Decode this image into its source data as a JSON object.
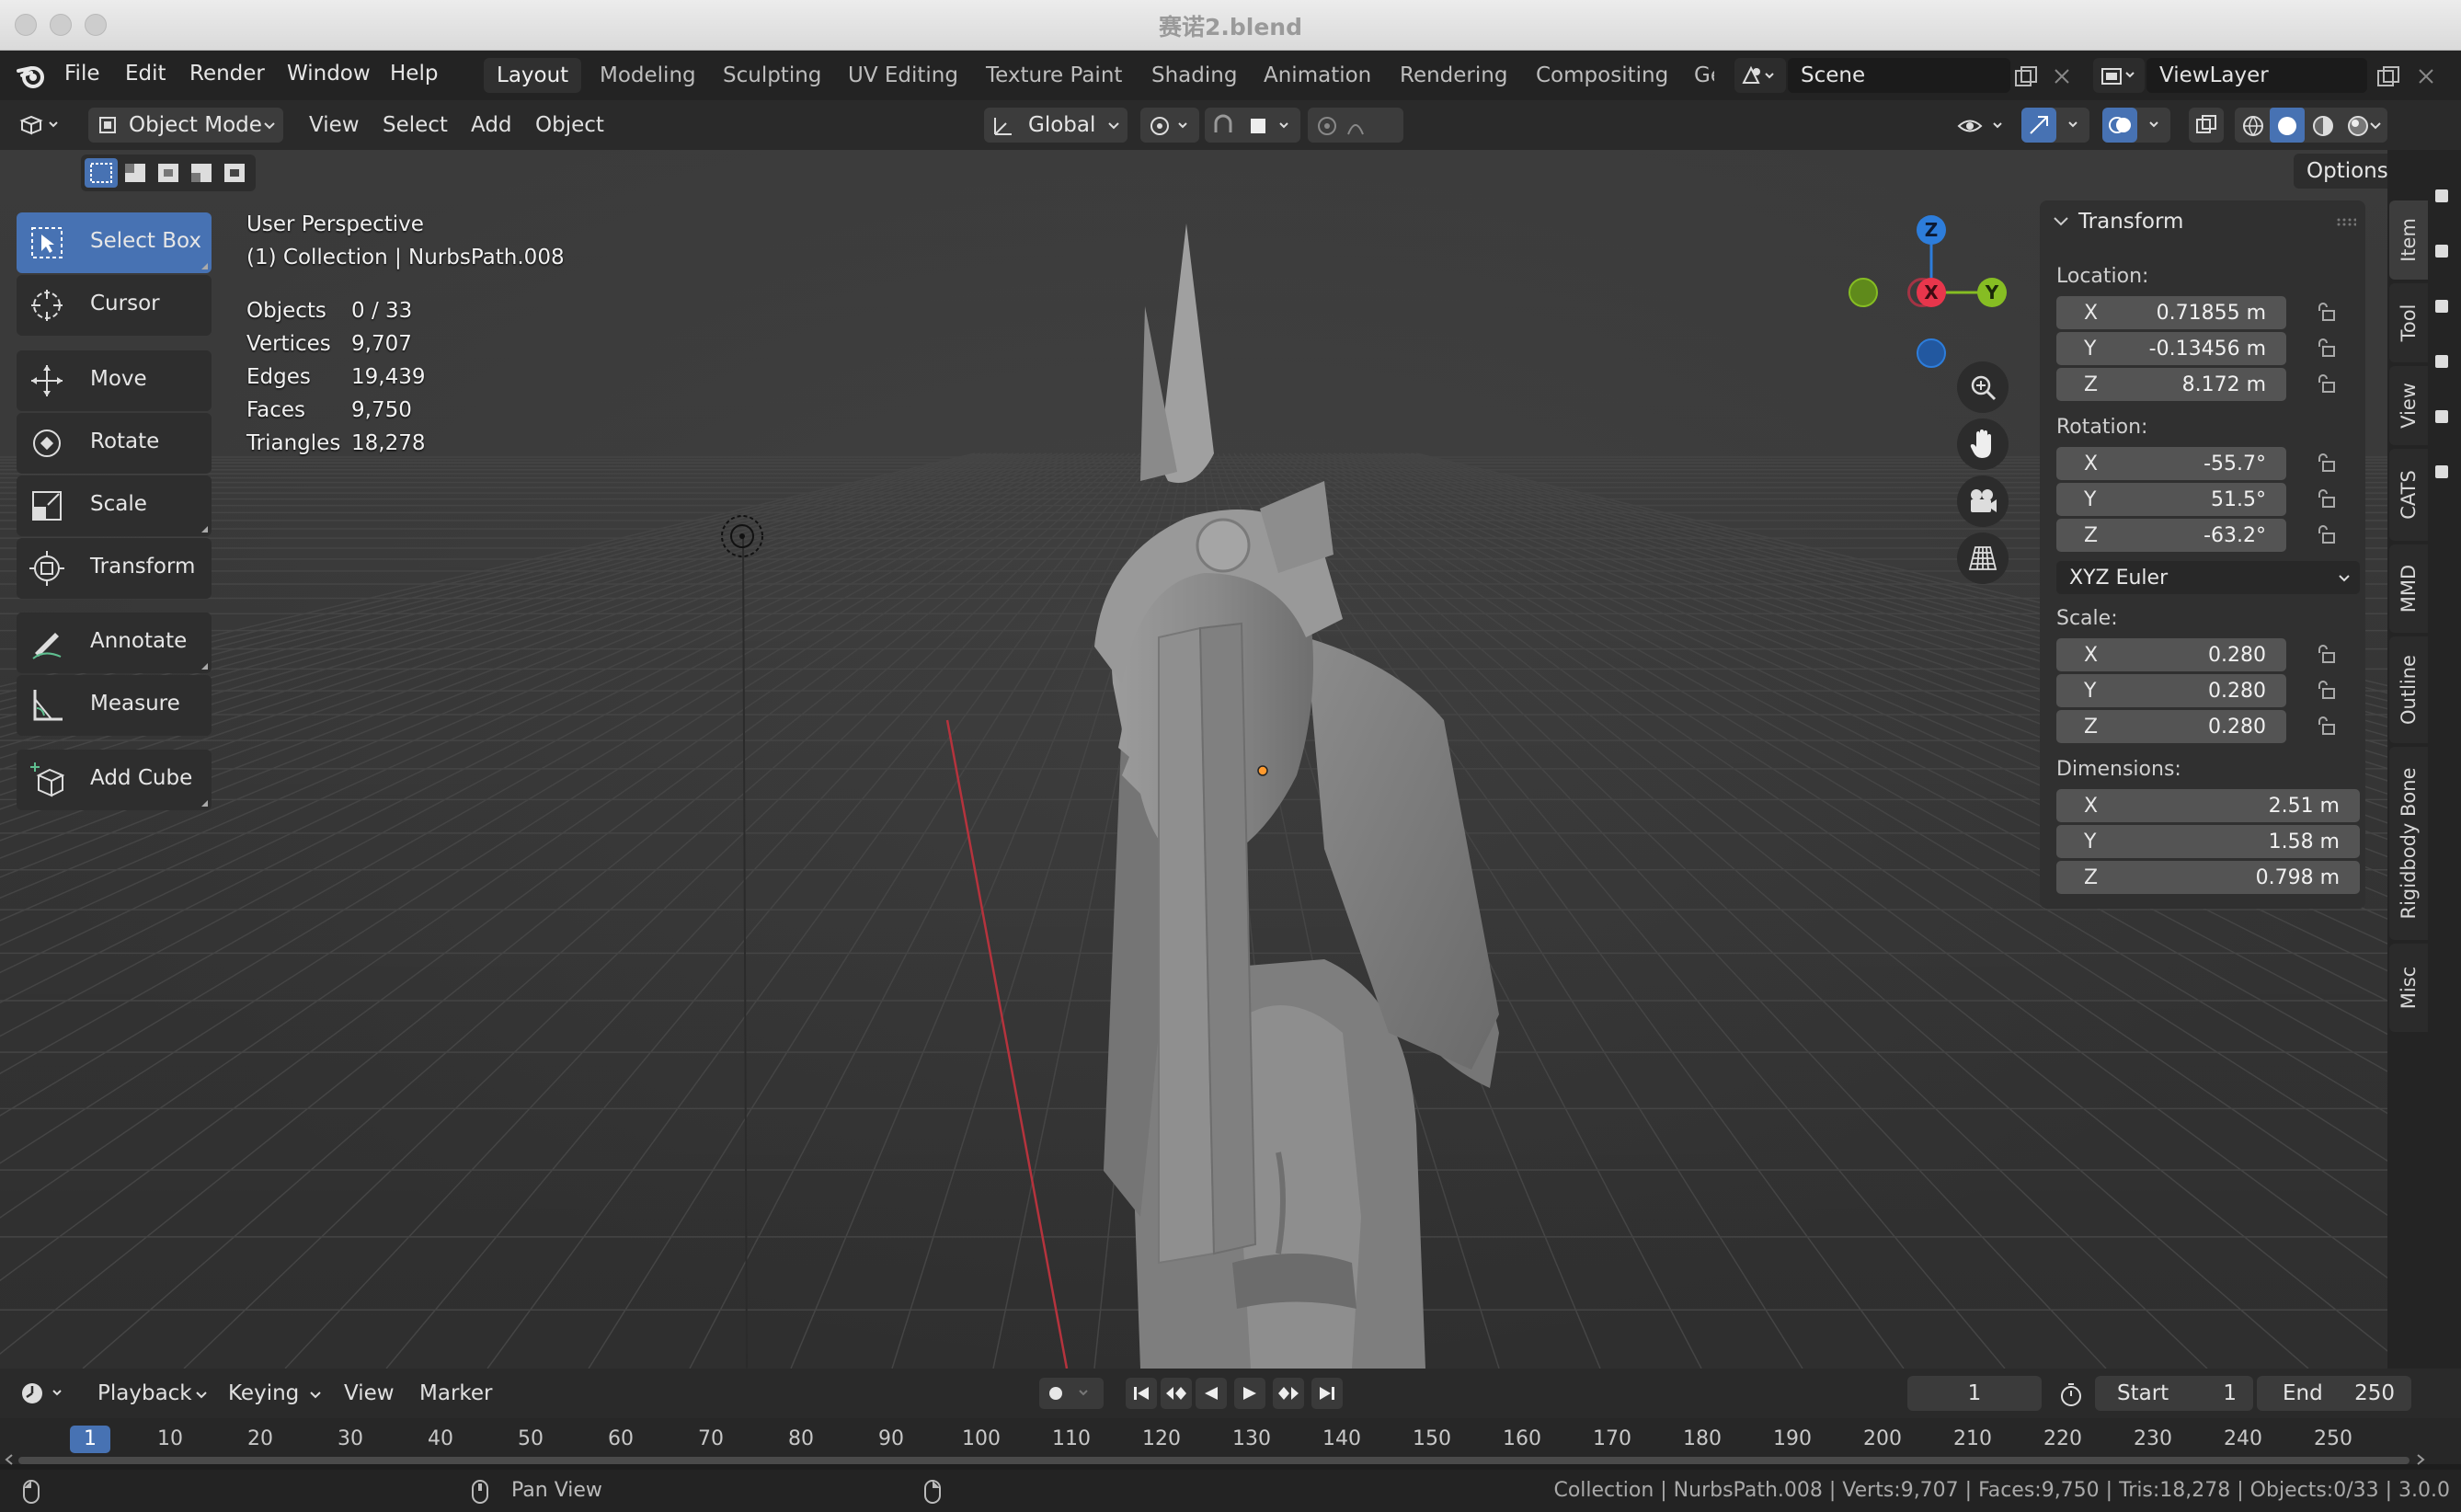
{
  "window": {
    "title": "赛诺2.blend"
  },
  "menu": {
    "items": [
      "File",
      "Edit",
      "Render",
      "Window",
      "Help"
    ]
  },
  "workspaces": {
    "tabs": [
      "Layout",
      "Modeling",
      "Sculpting",
      "UV Editing",
      "Texture Paint",
      "Shading",
      "Animation",
      "Rendering",
      "Compositing",
      "Ge"
    ],
    "active": "Layout"
  },
  "scene": {
    "name": "Scene",
    "view_layer": "ViewLayer"
  },
  "header": {
    "mode": "Object Mode",
    "view": "View",
    "select": "Select",
    "add": "Add",
    "object": "Object",
    "orientation": "Global",
    "options": "Options"
  },
  "toolbar": {
    "tools": [
      "Select Box",
      "Cursor",
      "Move",
      "Rotate",
      "Scale",
      "Transform",
      "Annotate",
      "Measure",
      "Add Cube"
    ],
    "active": "Select Box"
  },
  "viewport": {
    "perspective": "User Perspective",
    "collection": "(1) Collection | NurbsPath.008",
    "stats": [
      {
        "label": "Objects",
        "value": "0 / 33"
      },
      {
        "label": "Vertices",
        "value": "9,707"
      },
      {
        "label": "Edges",
        "value": "19,439"
      },
      {
        "label": "Faces",
        "value": "9,750"
      },
      {
        "label": "Triangles",
        "value": "18,278"
      }
    ],
    "gizmo": {
      "x": "X",
      "y": "Y",
      "z": "Z"
    }
  },
  "transform_panel": {
    "title": "Transform",
    "location_label": "Location:",
    "location": {
      "x": "0.71855 m",
      "y": "-0.13456 m",
      "z": "8.172 m"
    },
    "rotation_label": "Rotation:",
    "rotation": {
      "x": "-55.7°",
      "y": "51.5°",
      "z": "-63.2°"
    },
    "rotation_mode": "XYZ Euler",
    "scale_label": "Scale:",
    "scale": {
      "x": "0.280",
      "y": "0.280",
      "z": "0.280"
    },
    "dimensions_label": "Dimensions:",
    "dimensions": {
      "x": "2.51 m",
      "y": "1.58 m",
      "z": "0.798 m"
    },
    "axis_labels": {
      "x": "X",
      "y": "Y",
      "z": "Z"
    }
  },
  "sidebar_tabs": [
    "Item",
    "Tool",
    "View",
    "CATS",
    "MMD",
    "Outline",
    "Rigidbody Bone",
    "Misc"
  ],
  "timeline": {
    "playback": "Playback",
    "keying": "Keying",
    "view": "View",
    "marker": "Marker",
    "current_frame": "1",
    "start_label": "Start",
    "start": "1",
    "end_label": "End",
    "end": "250",
    "ruler": [
      "1",
      "10",
      "20",
      "30",
      "40",
      "50",
      "60",
      "70",
      "80",
      "90",
      "100",
      "110",
      "120",
      "130",
      "140",
      "150",
      "160",
      "170",
      "180",
      "190",
      "200",
      "210",
      "220",
      "230",
      "240",
      "250"
    ]
  },
  "statusbar": {
    "middle_hint": "Pan View",
    "info": "Collection | NurbsPath.008 | Verts:9,707 | Faces:9,750 | Tris:18,278 | Objects:0/33 | 3.0.0"
  },
  "colors": {
    "accent": "#4772b3",
    "gizmo_x": "#e8364c",
    "gizmo_y": "#86bd23",
    "gizmo_z": "#2d7ddb",
    "origin": "#ff9a2e"
  }
}
